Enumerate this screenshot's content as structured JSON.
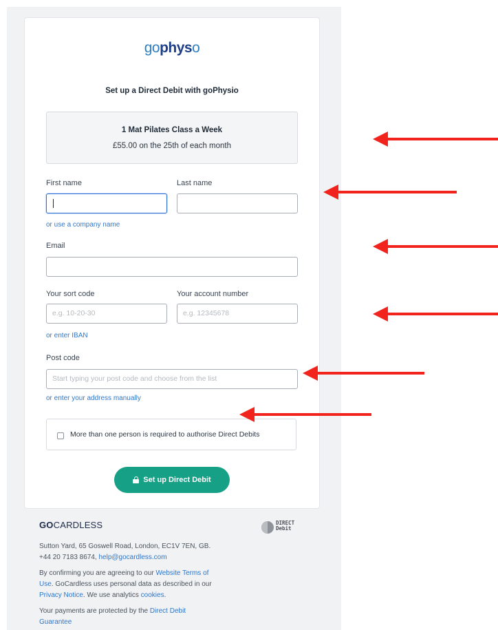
{
  "brand": {
    "logo_go": "go",
    "logo_physio": "phys",
    "logo_end": "o"
  },
  "setup_title": "Set up a Direct Debit with goPhysio",
  "plan": {
    "name": "1 Mat Pilates Class a Week",
    "price": "£55.00 on the 25th of each month"
  },
  "form": {
    "first_name_label": "First name",
    "last_name_label": "Last name",
    "company_link": "or use a company name",
    "email_label": "Email",
    "sort_code_label": "Your sort code",
    "sort_code_placeholder": "e.g. 10-20-30",
    "account_number_label": "Your account number",
    "account_number_placeholder": "e.g. 12345678",
    "iban_link": "or enter IBAN",
    "postcode_label": "Post code",
    "postcode_placeholder": "Start typing your post code and choose from the list",
    "address_link": "or enter your address manually",
    "multi_auth_label": "More than one person is required to authorise Direct Debits",
    "submit_label": "Set up Direct Debit"
  },
  "footer": {
    "gc_bold": "GO",
    "gc_rest": "CARDLESS",
    "dd_line1": "DIRECT",
    "dd_line2": "Debit",
    "address": "Sutton Yard, 65 Goswell Road, London, EC1V 7EN, GB.",
    "phone": "+44 20 7183 8674, ",
    "email": "help@gocardless.com",
    "terms_pre": "By confirming you are agreeing to our ",
    "terms_link": "Website Terms of",
    "terms_link2": "Use",
    "terms_mid": ". GoCardless uses personal data as described in our",
    "privacy_link": "Privacy Notice",
    "privacy_mid": ". We use analytics ",
    "cookies_link": "cookies",
    "cookies_end": ".",
    "protect_pre": "Your payments are protected by the ",
    "guarantee_link": "Direct Debit",
    "guarantee_link2": "Guarantee"
  },
  "colors": {
    "accent": "#16a085",
    "link": "#2f76c9",
    "arrow": "#f2231c"
  }
}
